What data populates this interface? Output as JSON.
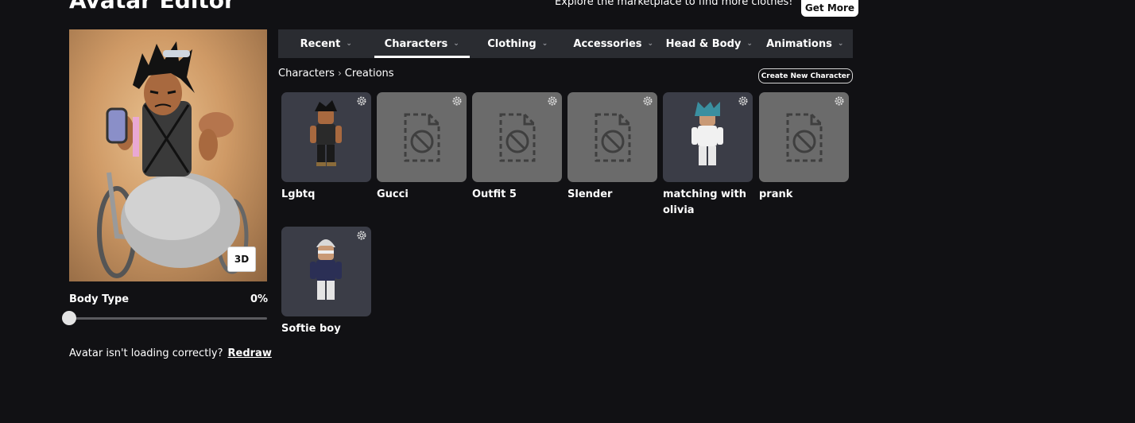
{
  "header": {
    "title": "Avatar Editor",
    "promo_text": "Explore the marketplace to find more clothes!",
    "get_more_label": "Get More"
  },
  "preview": {
    "btn_3d_label": "3D",
    "body_type_label": "Body Type",
    "body_type_value": "0%",
    "body_type_fraction": 0,
    "redraw_prompt": "Avatar isn't loading correctly?",
    "redraw_link": "Redraw"
  },
  "tabs": [
    {
      "label": "Recent",
      "active": false
    },
    {
      "label": "Characters",
      "active": true
    },
    {
      "label": "Clothing",
      "active": false
    },
    {
      "label": "Accessories",
      "active": false
    },
    {
      "label": "Head & Body",
      "active": false
    },
    {
      "label": "Animations",
      "active": false
    }
  ],
  "breadcrumb": {
    "parent": "Characters",
    "current": "Creations"
  },
  "create_button_label": "Create New Character",
  "outfits": [
    {
      "name": "Lgbtq",
      "thumb": "avatar",
      "variant": "dark"
    },
    {
      "name": "Gucci",
      "thumb": "unavailable",
      "variant": "grey"
    },
    {
      "name": "Outfit 5",
      "thumb": "unavailable",
      "variant": "grey"
    },
    {
      "name": "Slender",
      "thumb": "unavailable",
      "variant": "grey"
    },
    {
      "name": "matching with olivia",
      "thumb": "avatar",
      "variant": "white"
    },
    {
      "name": "prank",
      "thumb": "unavailable",
      "variant": "grey"
    },
    {
      "name": "Softie boy",
      "thumb": "avatar",
      "variant": "navy"
    }
  ],
  "icons": {
    "tab_chevron": "chevron-down-icon",
    "card_settings": "gear-icon",
    "unavailable": "unavailable-file-icon",
    "breadcrumb_separator": "chevron-right-icon"
  },
  "colors": {
    "background": "#111114",
    "tabbar": "#2a2c31",
    "card_dark": "#3b3d47",
    "card_unavailable": "#6b6b6b"
  }
}
